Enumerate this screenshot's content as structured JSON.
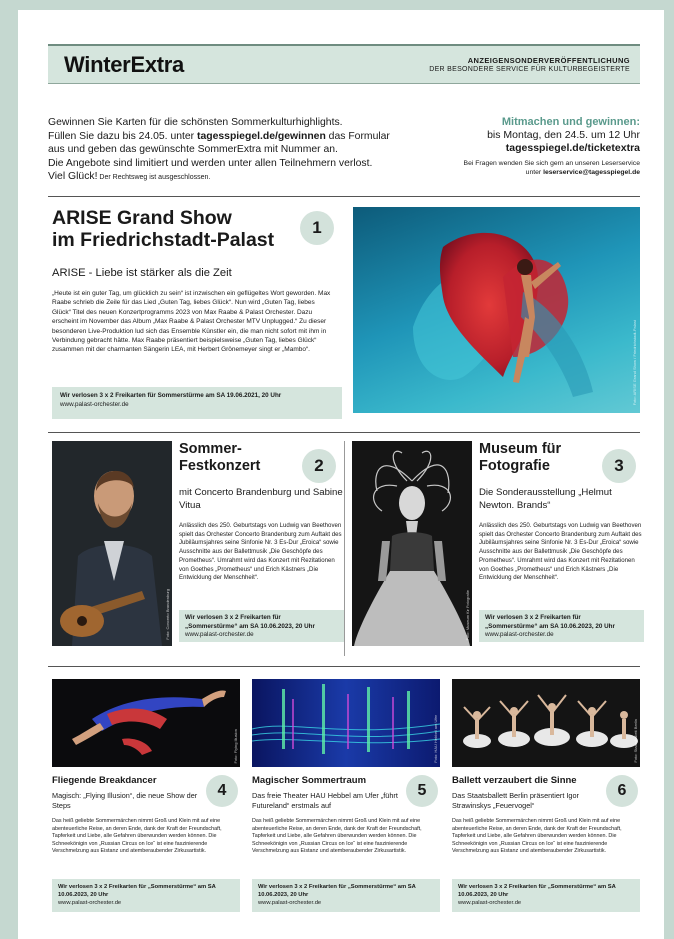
{
  "header": {
    "brand": "WinterExtra",
    "tag_line1": "ANZEIGENSONDERVERÖFFENTLICHUNG",
    "tag_line2": "DER BESONDERE SERVICE FÜR KULTURBEGEISTERTE"
  },
  "intro": {
    "line1": "Gewinnen Sie Karten für die schönsten Sommerkulturhighlights.",
    "line2a": "Füllen Sie dazu bis 24.05. unter ",
    "line2b": "tagesspiegel.de/gewinnen",
    "line2c": " das Formular",
    "line3": "aus und geben das gewünschte SommerExtra mit Nummer an.",
    "line4": "Die Angebote sind limitiert und werden unter allen Teilnehmern verlost.",
    "line5a": "Viel Glück!",
    "line5b": " Der Rechtsweg ist ausgeschlossen.",
    "right_title": "Mitmachen und gewinnen:",
    "right_date": "bis Montag, den 24.5. um 12 Uhr",
    "right_url": "tagesspiegel.de/ticketextra",
    "right_small1": "Bei Fragen wenden Sie sich gern an unseren Leserservice",
    "right_small2a": "unter ",
    "right_small2b": "leserservice@tagesspiegel.de"
  },
  "s1": {
    "title1": "ARISE Grand Show",
    "title2": "im Friedrichstadt-Palast",
    "num": "1",
    "subtitle": "ARISE - Liebe ist stärker als die Zeit",
    "body": "„Heute ist ein guter Tag, um glücklich zu sein“ ist inzwischen ein geflügeltes Wort geworden. Max Raabe schrieb die Zeile für das Lied „Guten Tag, liebes Glück“. Nun wird „Guten Tag, liebes Glück“ Titel des neuen Konzertprogramms 2023 von Max Raabe & Palast Orchester. Dazu erscheint im November das Album „Max Raabe & Palast Orchester MTV Unplugged.“ Zu dieser besonderen Live-Produktion lud sich das Ensemble Künstler ein, die man nicht sofort mit ihm in Verbindung gebracht hätte. Max Raabe präsentiert beispielsweise „Guten Tag, liebes Glück“ zusammen mit der charmanten Sängerin LEA, mit Herbert Grönemeyer singt er „Mambo“.",
    "win": "Wir verlosen 3 x 2 Freikarten für Sommerstürme am SA 19.06.2021, 20 Uhr",
    "url": "www.palast-orchester.de",
    "caption": "Foto: ARISE Grand Show / Friedrichstadt-Palast"
  },
  "s2": {
    "title": "Sommer-Festkonzert",
    "num": "2",
    "subtitle": "mit Concerto Brandenburg und Sabine Vitua",
    "body": "Anlässlich des 250. Geburtstags von Ludwig van Beethoven spielt das Orchester Concerto Brandenburg zum Auftakt des Jubiläumsjahres seine Sinfonie Nr. 3 Es-Dur „Eroica“ sowie Ausschnitte aus der Ballettmusik „Die Geschöpfe des Prometheus“. Umrahmt wird das Konzert mit Rezitationen von Goethes „Prometheus“ und Erich Kästners „Die Entwicklung der Menschheit“.",
    "win1": "Wir verlosen 3 x 2 Freikarten für",
    "win2": "„Sommerstürme“ am SA 10.06.2023, 20 Uhr",
    "url": "www.palast-orchester.de",
    "caption": "Foto: Concerto Brandenburg"
  },
  "s3": {
    "title": "Museum für Fotografie",
    "num": "3",
    "subtitle": "Die Sonderausstellung „Helmut Newton. Brands“",
    "body": "Anlässlich des 250. Geburtstags von Ludwig van Beethoven spielt das Orchester Concerto Brandenburg zum Auftakt des Jubiläumsjahres seine Sinfonie Nr. 3 Es-Dur „Eroica“ sowie Ausschnitte aus der Ballettmusik „Die Geschöpfe des Prometheus“. Umrahmt wird das Konzert mit Rezitationen von Goethes „Prometheus“ und Erich Kästners „Die Entwicklung der Menschheit“.",
    "win1": "Wir verlosen 3 x 2 Freikarten für",
    "win2": "„Sommerstürme“ am SA 10.06.2023, 20 Uhr",
    "url": "www.palast-orchester.de",
    "caption": "Foto: Museum für Fotografie"
  },
  "s4": {
    "title": "Fliegende Breakdancer",
    "num": "4",
    "subtitle": "Magisch: „Flying Illusion“, die neue Show der Steps",
    "body": "Das heiß geliebte Sommermärchen nimmt Groß und Klein mit auf eine abenteuerliche Reise, an deren Ende, dank der Kraft der Freundschaft, Tapferkeit und Liebe, alle Gefahren überwunden werden können. Die Schneekönigin von „Russian Circus on Ice“ ist eine faszinierende Verschmelzung aus Eistanz und atemberaubender Zirkusartistik.",
    "win": "Wir verlosen 3 x 2 Freikarten für „Sommerstürme“ am SA 10.06.2023, 20 Uhr",
    "url": "www.palast-orchester.de",
    "caption": "Foto: Flying Illusion"
  },
  "s5": {
    "title": "Magischer Sommertraum",
    "num": "5",
    "subtitle": "Das freie Theater HAU Hebbel am Ufer „führt Futureland“ erstmals auf",
    "body": "Das heiß geliebte Sommermärchen nimmt Groß und Klein mit auf eine abenteuerliche Reise, an deren Ende, dank der Kraft der Freundschaft, Tapferkeit und Liebe, alle Gefahren überwunden werden können. Die Schneekönigin von „Russian Circus on Ice“ ist eine faszinierende Verschmelzung aus Eistanz und atemberaubender Zirkusartistik.",
    "win": "Wir verlosen 3 x 2 Freikarten für „Sommerstürme“ am SA 10.06.2023, 20 Uhr",
    "url": "www.palast-orchester.de",
    "caption": "Foto: HAU Hebbel am Ufer"
  },
  "s6": {
    "title": "Ballett verzaubert die Sinne",
    "num": "6",
    "subtitle": "Das Staatsballett Berlin präsentiert Igor Strawinskys „Feuervogel“",
    "body": "Das heiß geliebte Sommermärchen nimmt Groß und Klein mit auf eine abenteuerliche Reise, an deren Ende, dank der Kraft der Freundschaft, Tapferkeit und Liebe, alle Gefahren überwunden werden können. Die Schneekönigin von „Russian Circus on Ice“ ist eine faszinierende Verschmelzung aus Eistanz und atemberaubender Zirkusartistik.",
    "win": "Wir verlosen 3 x 2 Freikarten für „Sommerstürme“ am SA 10.06.2023, 20 Uhr",
    "url": "www.palast-orchester.de",
    "caption": "Foto: Staatsballett Berlin"
  },
  "colors": {
    "accent": "#5a9a8c",
    "box": "#d5e5dd",
    "frame": "#c5d8d0"
  }
}
